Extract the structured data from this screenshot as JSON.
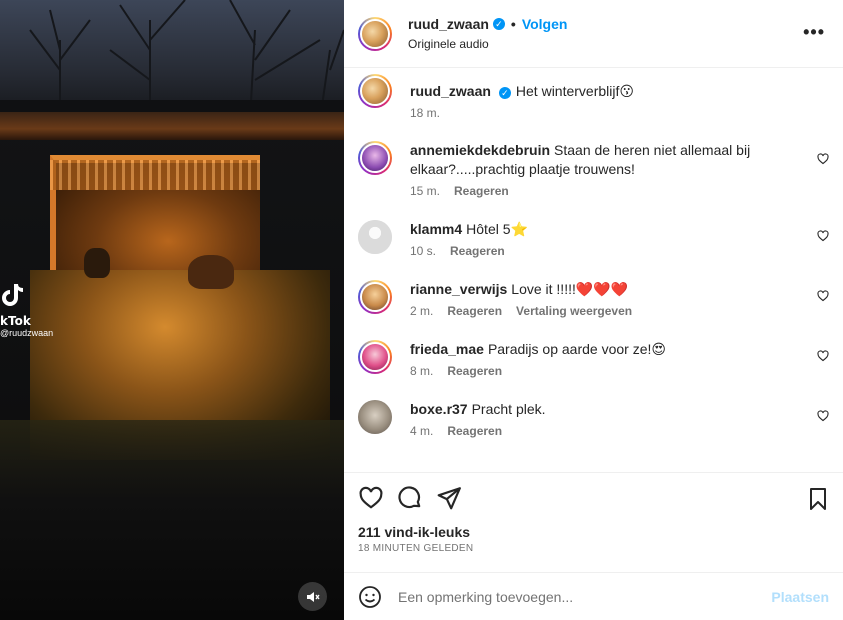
{
  "header": {
    "username": "ruud_zwaan",
    "follow_label": "Volgen",
    "separator": "•",
    "audio_label": "Originele audio",
    "more_label": "•••"
  },
  "media": {
    "watermark_name": "kTok",
    "watermark_handle": "@ruudzwaan",
    "watermark_icon": "tiktok-icon",
    "mute_icon": "speaker-muted-icon"
  },
  "caption": {
    "username": "ruud_zwaan",
    "text": "Het winterverblijf😗",
    "time": "18 m."
  },
  "comments": [
    {
      "username": "annemiekdekdebruin",
      "text": "Staan de heren niet allemaal bij elkaar?.....prachtig plaatje trouwens!",
      "time": "15 m.",
      "reply": "Reageren",
      "translate": ""
    },
    {
      "username": "klamm4",
      "text": "Hôtel 5⭐",
      "time": "10 s.",
      "reply": "Reageren",
      "translate": ""
    },
    {
      "username": "rianne_verwijs",
      "text": "Love it !!!!!❤️❤️❤️",
      "time": "2 m.",
      "reply": "Reageren",
      "translate": "Vertaling weergeven"
    },
    {
      "username": "frieda_mae",
      "text": "Paradijs op aarde voor ze!😍",
      "time": "8 m.",
      "reply": "Reageren",
      "translate": ""
    },
    {
      "username": "boxe.r37",
      "text": "Pracht plek.",
      "time": "4 m.",
      "reply": "Reageren",
      "translate": ""
    }
  ],
  "actions": {
    "likes": "211 vind-ik-leuks",
    "posted": "18 MINUTEN GELEDEN"
  },
  "composer": {
    "placeholder": "Een opmerking toevoegen...",
    "post_label": "Plaatsen"
  },
  "colors": {
    "accent": "#0095f6",
    "post_disabled": "#b2dffc",
    "secondary_text": "#737373"
  }
}
